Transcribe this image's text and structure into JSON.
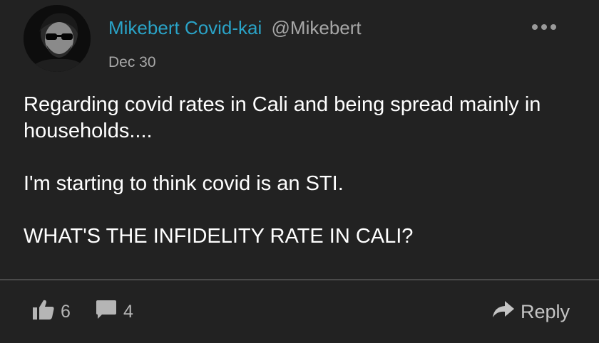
{
  "post": {
    "author": {
      "display_name": "Mikebert Covid-kai",
      "handle": "@Mikebert"
    },
    "date": "Dec 30",
    "paragraphs": [
      "Regarding covid rates in Cali and being spread mainly in households....",
      "I'm starting to think covid is an STI.",
      "WHAT'S THE INFIDELITY RATE IN CALI?"
    ],
    "likes_count": "6",
    "comments_count": "4",
    "reply_label": "Reply"
  },
  "icons": {
    "avatar": "avatar-photo",
    "more": "more-dots-icon",
    "like": "thumbs-up-icon",
    "comment": "comment-bubble-icon",
    "reply": "reply-arrow-icon"
  },
  "colors": {
    "background": "#222222",
    "display_name": "#2aa3c7",
    "muted": "#a7a7a7",
    "body_text": "#ffffff",
    "divider": "#4a4a4a"
  }
}
